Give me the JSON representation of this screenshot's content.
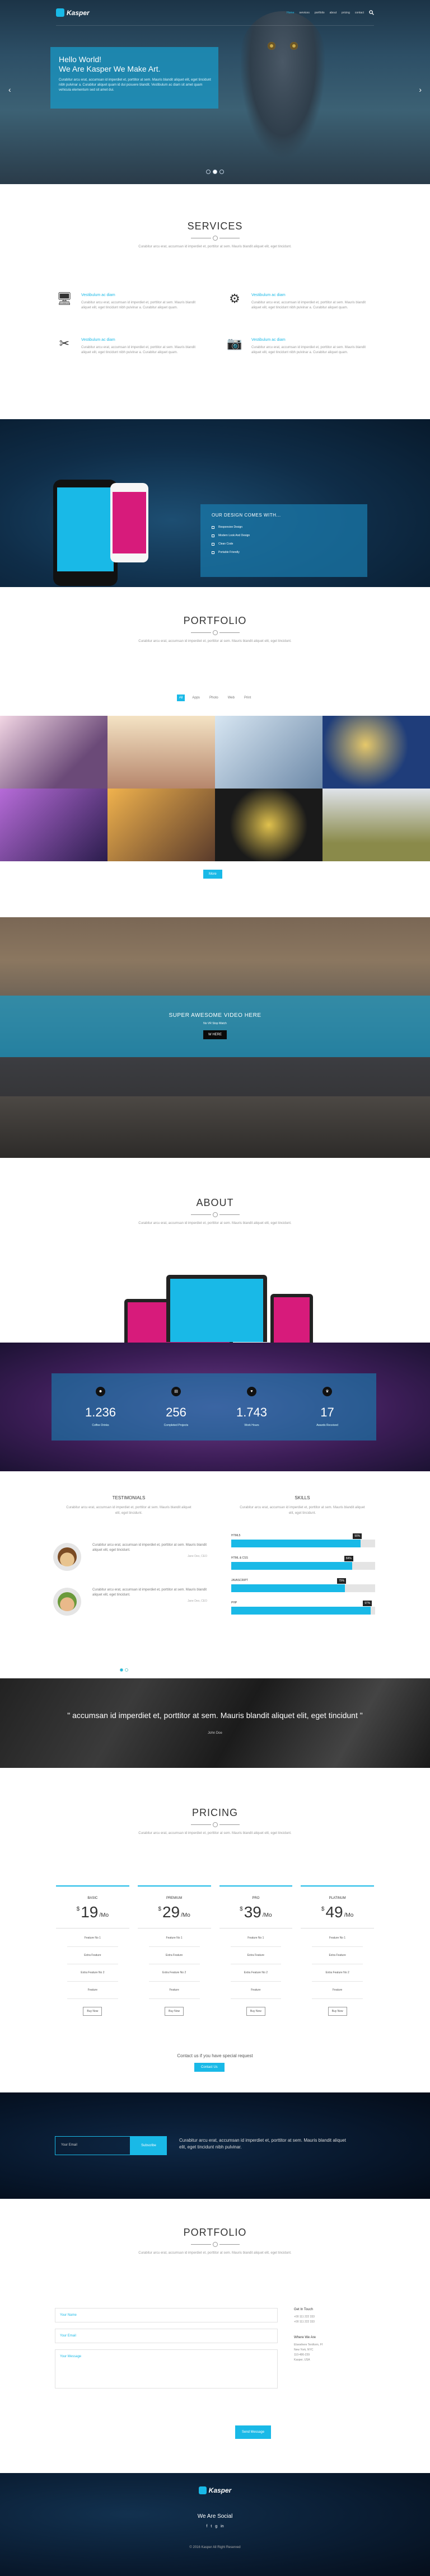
{
  "colors": {
    "accent": "#19b9e7",
    "magenta": "#d71b7b",
    "dark": "#222222"
  },
  "header": {
    "logo": "Kasper",
    "nav": [
      "Home",
      "services",
      "portfolio",
      "about",
      "pricing",
      "contact"
    ],
    "search_icon": "search-icon",
    "hero_title_1": "Hello World!",
    "hero_title_2": "We Are Kasper We Make Art.",
    "hero_text": "Curabitur arcu erat, accumsan id imperdiet et, porttitor at sem. Mauris blandit aliquet elit, eget tincidunt nibh pulvinar a. Curabitur aliquet quam id dui posuere blandit. Vestibulum ac diam sit amet quam vehicula elementum sed sit amet dui.",
    "prev": "‹",
    "next": "›"
  },
  "services": {
    "title": "Services",
    "intro": "Curabitur arcu erat, accumsan id imperdiet et, porttitor at sem. Mauris blandit aliquet elit, eget tincidunt.",
    "items": [
      {
        "icon": "monitor-icon",
        "glyph": "🖥",
        "title": "Vestibulum ac diam",
        "text": "Curabitur arcu erat, accumsan id imperdiet et, porttitor at sem. Mauris blandit aliquet elit, eget tincidunt nibh pulvinar a. Curabitur aliquet quam."
      },
      {
        "icon": "gear-icon",
        "glyph": "⚙",
        "title": "Vestibulum ac diam",
        "text": "Curabitur arcu erat, accumsan id imperdiet et, porttitor at sem. Mauris blandit aliquet elit, eget tincidunt nibh pulvinar a. Curabitur aliquet quam."
      },
      {
        "icon": "tools-icon",
        "glyph": "✂",
        "title": "Vestibulum ac diam",
        "text": "Curabitur arcu erat, accumsan id imperdiet et, porttitor at sem. Mauris blandit aliquet elit, eget tincidunt nibh pulvinar a. Curabitur aliquet quam."
      },
      {
        "icon": "camera-icon",
        "glyph": "📷",
        "title": "Vestibulum ac diam",
        "text": "Curabitur arcu erat, accumsan id imperdiet et, porttitor at sem. Mauris blandit aliquet elit, eget tincidunt nibh pulvinar a. Curabitur aliquet quam."
      }
    ]
  },
  "design": {
    "title": "OUR DESIGN COMES WITH...",
    "items": [
      "Responsive Design",
      "Modern Look And Design",
      "Clean Code",
      "Portable Friendly"
    ]
  },
  "portfolio": {
    "title": "Portfolio",
    "intro": "Curabitur arcu erat, accumsan id imperdiet et, porttitor at sem. Mauris blandit aliquet elit, eget tincidunt.",
    "filters": [
      "All",
      "Apps",
      "Photo",
      "Web",
      "Print"
    ],
    "more": "More",
    "tiles": [
      "#6b4a78",
      "#c9b59a",
      "#9fb5c9",
      "#1f3d7a",
      "#6c4fa0",
      "#b77d52",
      "#2b2b2b",
      "#8a8a4a"
    ]
  },
  "video": {
    "title": "SUPER AWESOME VIDEO HERE",
    "sub": "No VR Stop Watch",
    "btn": "W HERE"
  },
  "about": {
    "title": "About",
    "intro": "Curabitur arcu erat, accumsan id imperdiet et, porttitor at sem. Mauris blandit aliquet elit, eget tincidunt."
  },
  "stats": [
    {
      "icon": "user-icon",
      "glyph": "☻",
      "num": "1.236",
      "label": "Coffee Drinks"
    },
    {
      "icon": "folder-icon",
      "glyph": "▤",
      "num": "256",
      "label": "Completed Projects"
    },
    {
      "icon": "heart-icon",
      "glyph": "♥",
      "num": "1.743",
      "label": "Work Hours"
    },
    {
      "icon": "trophy-icon",
      "glyph": "♛",
      "num": "17",
      "label": "Awards Received"
    }
  ],
  "testimonials": {
    "title": "Testimonials",
    "intro": "Curabitur arcu erat, accumsan id imperdiet et, porttitor at sem. Mauris blandit aliquet elit, eget tincidunt.",
    "items": [
      {
        "text": "Curabitur arcu erat, accumsan id imperdiet et, porttitor at sem. Mauris blandit aliquet elit, eget tincidunt.",
        "meta": "Jane Deo, CEO",
        "face": "#e8c48f",
        "hair": "#7a4b24"
      },
      {
        "text": "Curabitur arcu erat, accumsan id imperdiet et, porttitor at sem. Mauris blandit aliquet elit, eget tincidunt.",
        "meta": "Jane Deo, CEO",
        "face": "#e9b98a",
        "hair": "#6b9a3c"
      }
    ]
  },
  "skills": {
    "title": "Skills",
    "intro": "Curabitur arcu erat, accumsan id imperdiet et, porttitor at sem. Mauris blandit aliquet elit, eget tincidunt.",
    "items": [
      {
        "name": "HTML5",
        "pct": "90%",
        "value": 0.9
      },
      {
        "name": "HTML & CSS",
        "pct": "84%",
        "value": 0.84
      },
      {
        "name": "JAVASCRIPT",
        "pct": "79%",
        "value": 0.79
      },
      {
        "name": "PHP",
        "pct": "97%",
        "value": 0.97
      }
    ]
  },
  "quote": {
    "text": "\" accumsan id imperdiet et, porttitor at sem. Mauris blandit aliquet elit, eget tincidunt \"",
    "by": "John Doe"
  },
  "pricing": {
    "title": "Pricing",
    "intro": "Curabitur arcu erat, accumsan id imperdiet et, porttitor at sem. Mauris blandit aliquet elit, eget tincidunt.",
    "plans": [
      {
        "name": "Basic",
        "currency": "$",
        "price": "19",
        "per": "/Mo"
      },
      {
        "name": "Premium",
        "currency": "$",
        "price": "29",
        "per": "/Mo"
      },
      {
        "name": "Pro",
        "currency": "$",
        "price": "39",
        "per": "/Mo"
      },
      {
        "name": "Platinum",
        "currency": "$",
        "price": "49",
        "per": "/Mo"
      }
    ],
    "features": [
      "Feature No 1",
      "Extra Feature",
      "Extra Feature No 2",
      "Feature"
    ],
    "buy": "Buy Now",
    "special": "Contact us if you have special request",
    "contact_btn": "Contact Us"
  },
  "subscribe": {
    "placeholder": "Your Email",
    "btn": "Subscribe",
    "text": "Curabitur arcu erat, accumsan id imperdiet et, porttitor at sem. Mauris blandit aliquet elit, eget tincidunt nibh pulvinar."
  },
  "contact": {
    "title": "Portfolio",
    "intro": "Curabitur arcu erat, accumsan id imperdiet et, porttitor at sem. Mauris blandit aliquet elit, eget tincidunt.",
    "name_ph": "Your Name",
    "email_ph": "Your Email",
    "msg_ph": "Your Message",
    "send": "Send Message",
    "touch_title": "Get In Touch",
    "touch_lines": [
      "+00 111 222 333",
      "+00 111 222 333"
    ],
    "where_title": "Where We Are",
    "where_lines": [
      "Elsewhere Teniform, Ff",
      "New York, NYC",
      "110-486-239",
      "Kasper, USA"
    ]
  },
  "footer": {
    "logo": "Kasper",
    "social_title": "We Are Social",
    "social": [
      "f",
      "t",
      "g",
      "in"
    ],
    "copyright": "© 2016 Kasper All Right Reserved"
  }
}
